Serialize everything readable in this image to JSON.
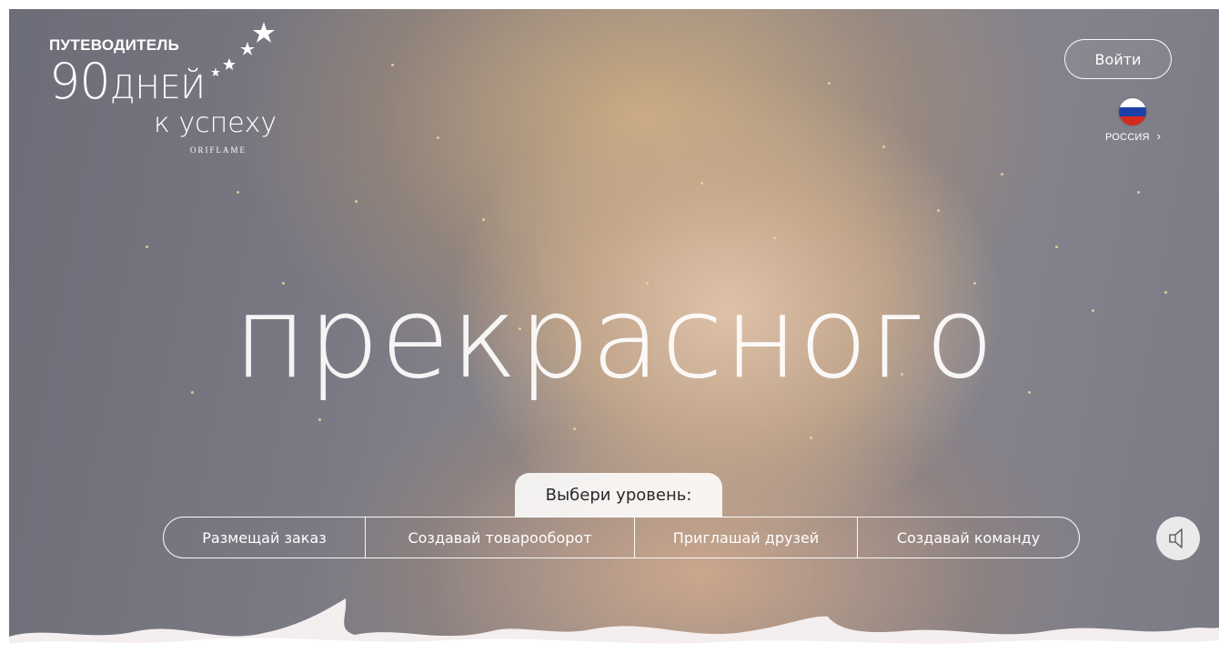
{
  "logo": {
    "guide": "ПУТЕВОДИТЕЛЬ",
    "days_number": "90",
    "days_word": "ДНЕЙ",
    "success": "к успеху",
    "brand": "ORIFLAME"
  },
  "header": {
    "login_label": "Войти",
    "country_label": "РОССИЯ",
    "country_chevron": "›"
  },
  "hero": {
    "headline": "прекрасного"
  },
  "levels": {
    "title": "Выбери уровень:",
    "tabs": [
      {
        "label": "Размещай заказ"
      },
      {
        "label": "Создавай товарооборот"
      },
      {
        "label": "Приглашай друзей"
      },
      {
        "label": "Создавай команду"
      }
    ]
  },
  "icons": {
    "sound": "speaker-icon",
    "flag": "russia-flag-icon",
    "stars": "stars-icon"
  }
}
